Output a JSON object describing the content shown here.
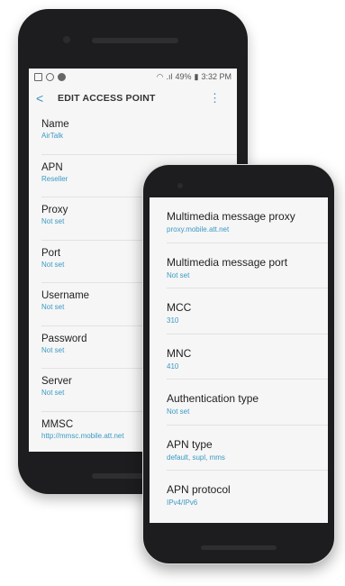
{
  "status_bar": {
    "battery": "49%",
    "time": "3:32 PM"
  },
  "header": {
    "title": "EDIT ACCESS POINT",
    "back_icon": "chevron-left-icon",
    "menu_icon": "more-vert-icon"
  },
  "accent": "#3b9ac4",
  "phone1_items": [
    {
      "label": "Name",
      "value": "AirTalk"
    },
    {
      "label": "APN",
      "value": "Reseller"
    },
    {
      "label": "Proxy",
      "value": "Not set"
    },
    {
      "label": "Port",
      "value": "Not set"
    },
    {
      "label": "Username",
      "value": "Not set"
    },
    {
      "label": "Password",
      "value": "Not set"
    },
    {
      "label": "Server",
      "value": "Not set"
    },
    {
      "label": "MMSC",
      "value": "http://mmsc.mobile.att.net"
    }
  ],
  "phone2_items": [
    {
      "label": "Multimedia message proxy",
      "value": "proxy.mobile.att.net"
    },
    {
      "label": "Multimedia message port",
      "value": "Not set"
    },
    {
      "label": "MCC",
      "value": "310"
    },
    {
      "label": "MNC",
      "value": "410"
    },
    {
      "label": "Authentication type",
      "value": "Not set"
    },
    {
      "label": "APN type",
      "value": "default, supl, mms"
    },
    {
      "label": "APN protocol",
      "value": "IPv4/IPv6"
    }
  ]
}
